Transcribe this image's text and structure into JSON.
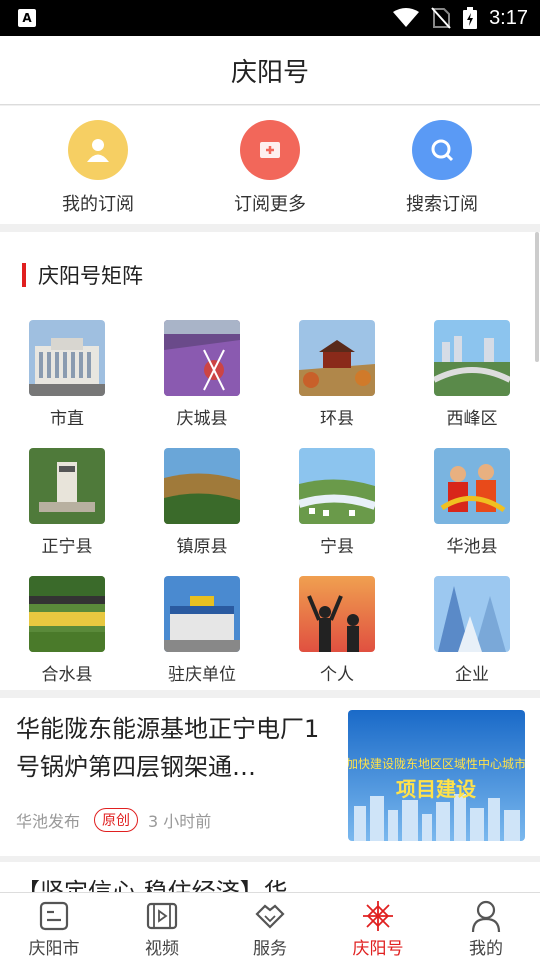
{
  "status": {
    "time": "3:17",
    "left_icon": "A"
  },
  "header": {
    "title": "庆阳号"
  },
  "quick": [
    {
      "label": "我的订阅",
      "icon": "user-icon",
      "color": "#f6cf63"
    },
    {
      "label": "订阅更多",
      "icon": "plus-icon",
      "color": "#f2675a"
    },
    {
      "label": "搜索订阅",
      "icon": "search-icon",
      "color": "#5a9af5"
    }
  ],
  "matrix": {
    "title": "庆阳号矩阵",
    "items": [
      {
        "name": "市直"
      },
      {
        "name": "庆城县"
      },
      {
        "name": "环县"
      },
      {
        "name": "西峰区"
      },
      {
        "name": "正宁县"
      },
      {
        "name": "镇原县"
      },
      {
        "name": "宁县"
      },
      {
        "name": "华池县"
      },
      {
        "name": "合水县"
      },
      {
        "name": "驻庆单位"
      },
      {
        "name": "个人"
      },
      {
        "name": "企业"
      }
    ]
  },
  "article": {
    "headline": "华能陇东能源基地正宁电厂1号锅炉第四层钢架通…",
    "source": "华池发布",
    "badge": "原创",
    "time": "3 小时前",
    "image_text_top": "加快建设陇东地区区域性中心城市",
    "image_text_bottom": "项目建设"
  },
  "article2": {
    "headline": "【坚定信心 稳住经济】华"
  },
  "tabs": [
    {
      "label": "庆阳市",
      "icon": "news-icon",
      "active": false
    },
    {
      "label": "视频",
      "icon": "video-icon",
      "active": false
    },
    {
      "label": "服务",
      "icon": "handshake-icon",
      "active": false
    },
    {
      "label": "庆阳号",
      "icon": "emblem-icon",
      "active": true
    },
    {
      "label": "我的",
      "icon": "profile-icon",
      "active": false
    }
  ]
}
